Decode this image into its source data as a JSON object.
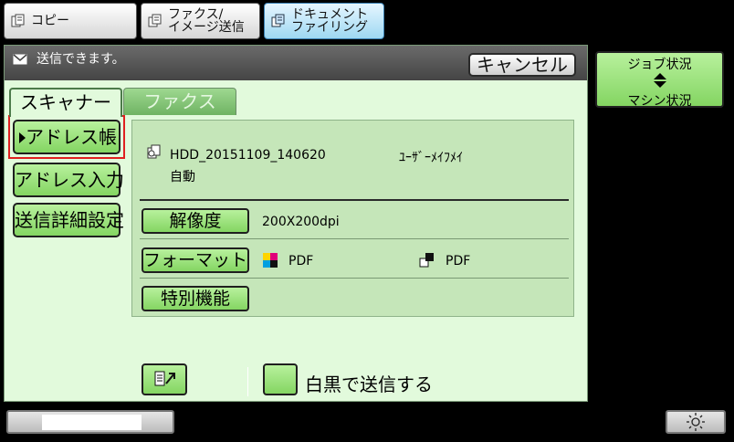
{
  "mode_tabs": {
    "copy": {
      "label": "コピー",
      "icon": "copy-icon"
    },
    "fax": {
      "line1": "ファクス/",
      "line2": "イメージ送信",
      "icon": "fax-icon"
    },
    "doc_filing": {
      "line1": "ドキュメント",
      "line2": "ファイリング",
      "icon": "document-filing-icon",
      "active": true
    }
  },
  "message_bar": {
    "icon": "mail-icon",
    "text": "送信できます。"
  },
  "cancel_label": "キャンセル",
  "tabs": [
    {
      "label": "スキャナー",
      "active": true
    },
    {
      "label": "ファクス",
      "active": false
    }
  ],
  "side_buttons": {
    "address_book": "アドレス帳",
    "address_input": "アドレス入力",
    "send_detail": "送信詳細設定"
  },
  "info": {
    "file_name": "HDD_20151109_140620",
    "user_name": "ﾕｰｻﾞｰﾒｲﾌﾒｲ",
    "auto": "自動"
  },
  "settings": {
    "resolution_label": "解像度",
    "resolution_value": "200X200dpi",
    "format_label": "フォーマット",
    "format_color": "PDF",
    "format_bw": "PDF",
    "special_label": "特別機能"
  },
  "bw_send_label": "白黒で送信する",
  "job_status": {
    "line1": "ジョブ状況",
    "line2": "マシン状況"
  },
  "colors": {
    "panel": "#e2fadc",
    "button_green": "#9ee27d",
    "active_tab_blue": "#9ed8f2",
    "highlight_red": "#e02020"
  }
}
